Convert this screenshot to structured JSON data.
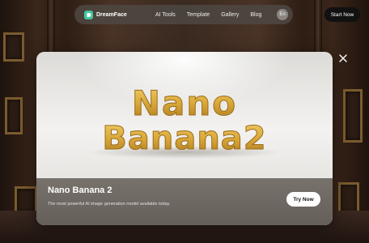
{
  "navbar": {
    "brand": "DreamFace",
    "links": [
      "AI Tools",
      "Template",
      "Gallery",
      "Blog"
    ],
    "language": "En",
    "cta_label": "Start Now"
  },
  "modal": {
    "hero_line1": "Nano",
    "hero_line2": "Banana2",
    "title": "Nano Banana 2",
    "description": "The most powerful AI image generation model available today.",
    "cta_label": "Try Now"
  },
  "icons": {
    "logo": "dreamface-logo-icon",
    "close": "close-icon"
  },
  "colors": {
    "brand": "#43c59e",
    "balloon_gold": "#d9a83a"
  }
}
